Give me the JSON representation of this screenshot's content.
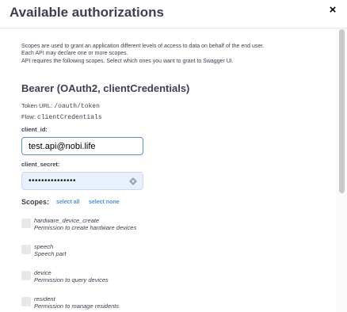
{
  "modal": {
    "title": "Available authorizations",
    "close_icon": "close-icon",
    "close_glyph": "×"
  },
  "description": {
    "line1": "Scopes are used to grant an application different levels of access to data on behalf of the end user.",
    "line2": "Each API may declare one or more scopes.",
    "line3": "API requires the following scopes. Select which ones you want to grant to Swagger UI."
  },
  "auth": {
    "title": "Bearer (OAuth2, clientCredentials)",
    "token_url_label": "Token URL:",
    "token_url": "/oauth/token",
    "flow_label": "Flow:",
    "flow": "clientCredentials",
    "client_id_label": "client_id:",
    "client_id_value": "test.api@nobi.life",
    "client_secret_label": "client_secret:",
    "client_secret_value": "•••••••••••••••",
    "client_secret_icon": "key-icon"
  },
  "scopes": {
    "label": "Scopes:",
    "select_all": "select all",
    "select_none": "select none",
    "items": [
      {
        "name": "hardware_device_create",
        "description": "Permission to create hardware devices"
      },
      {
        "name": "speech",
        "description": "Speech part"
      },
      {
        "name": "device",
        "description": "Permission to query devices"
      },
      {
        "name": "resident",
        "description": "Permission to manage residents"
      }
    ]
  },
  "colors": {
    "text": "#3b4151",
    "link": "#4990e2",
    "input_focus_border": "#5b92c7",
    "autofill_bg": "#e8f0fe"
  }
}
